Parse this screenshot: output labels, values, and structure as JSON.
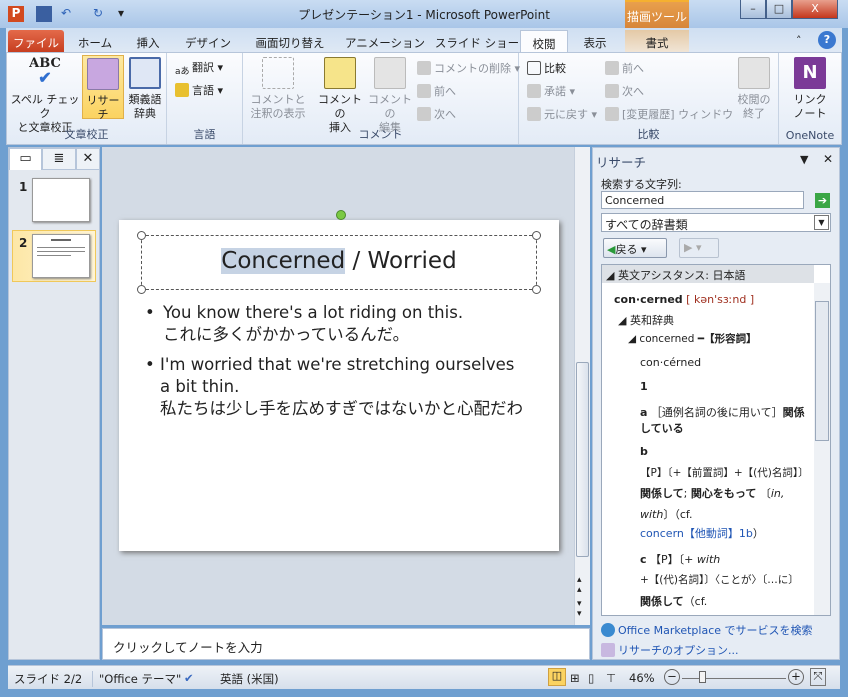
{
  "window": {
    "title": "プレゼンテーション1 - Microsoft PowerPoint",
    "context_tab_group": "描画ツール"
  },
  "tabs": [
    "ファイル",
    "ホーム",
    "挿入",
    "デザイン",
    "画面切り替え",
    "アニメーション",
    "スライド ショー",
    "校閲",
    "表示",
    "書式"
  ],
  "active_tab": "校閲",
  "ribbon": {
    "proofing": {
      "label": "文章校正",
      "spell": [
        "スペル チェック",
        "と文章校正"
      ],
      "research": "リサーチ",
      "thesaurus": [
        "類義語",
        "辞典"
      ]
    },
    "language": {
      "label": "言語",
      "translate": "翻訳",
      "language": "言語"
    },
    "comments": {
      "label": "コメント",
      "show": [
        "コメントと",
        "注釈の表示"
      ],
      "insert": [
        "コメントの",
        "挿入"
      ],
      "edit": [
        "コメントの",
        "編集"
      ],
      "delete": "コメントの削除",
      "prev": "前へ",
      "next": "次へ"
    },
    "compare": {
      "label": "比較",
      "compare": "比較",
      "accept": "承諾",
      "reject": "元に戻す",
      "prev": "前へ",
      "next": "次へ",
      "pane": "[変更履歴] ウィンドウ",
      "end": [
        "校閲の",
        "終了"
      ]
    },
    "onenote": {
      "label": "OneNote",
      "linked": [
        "リンク",
        "ノート"
      ]
    }
  },
  "slides": [
    {
      "number": "1"
    },
    {
      "number": "2"
    }
  ],
  "slide": {
    "title_highlight": "Concerned",
    "title_rest": " / Worried",
    "bullets": [
      {
        "en": "You know there's a lot riding on this.",
        "ja": "これに多くがかかっているんだ。"
      },
      {
        "en": "I'm worried that we're stretching ourselves a bit thin.",
        "ja": "私たちは少し手を広めすぎではないかと心配だわ"
      }
    ]
  },
  "notes_placeholder": "クリックしてノートを入力",
  "research": {
    "title": "リサーチ",
    "search_label": "検索する文字列:",
    "search_value": "Concerned",
    "source": "すべての辞書類",
    "back": "戻る",
    "section": "英文アシスタンス: 日本語",
    "headword": "con·cerned",
    "pron": "[ kən'sɜːnd ]",
    "dict": "英和辞典",
    "entry": "concerned",
    "pos": "━【形容詞】",
    "syll": "con·cérned",
    "lines": [
      "1",
      "a",
      "［通例名詞の後に用いて］",
      "関係",
      "している",
      "b",
      "【P】〔+【前置詞】+【(代)名詞】〕",
      "関係して",
      "; ",
      "関心をもって",
      "〔",
      "in,",
      "with",
      "〕（cf.",
      "concern【他動詞】1b",
      "）",
      "c",
      "【P】〔+ ",
      "with",
      "+【(代)名詞】〕〈ことが〉〔…に〕",
      "関係して",
      "（cf."
    ],
    "marketplace": "Office Marketplace でサービスを検索",
    "options": "リサーチのオプション..."
  },
  "status": {
    "slide": "スライド 2/2",
    "theme": "\"Office テーマ\"",
    "language": "英語 (米国)",
    "zoom": "46%",
    "zoom_percent": 46
  }
}
